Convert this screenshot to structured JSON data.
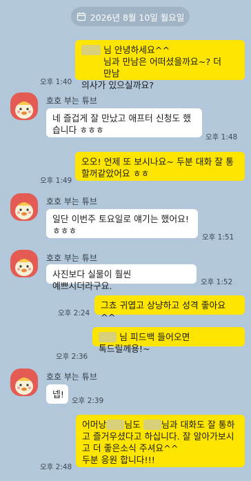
{
  "date_divider": "2026년 8월 10일 월요일",
  "colors": {
    "background": "#b2c7d9",
    "my_bubble": "#fee500",
    "their_bubble": "#ffffff",
    "avatar": "#e35b53"
  },
  "sender_name": "호호 부는 튜브",
  "messages": [
    {
      "from": "me",
      "lines": [
        "님 안녕하세요^^",
        "님과 만남은 어떠셨을까요~? 더 만남",
        "의사가 있으실까요?"
      ],
      "time": "오후 1:40"
    },
    {
      "from": "them",
      "lines": [
        "네 즐겁게 잘 만났고 애프터 신청도 했",
        "습니다 ㅎㅎㅎ"
      ],
      "time": "오후 1:48"
    },
    {
      "from": "me",
      "lines": [
        "오오! 언제 또 보시나요~ 두분 대화 잘 통",
        "할꺼같았어요 ㅎㅎ"
      ],
      "time": "오후 1:49"
    },
    {
      "from": "them",
      "lines": [
        "일단 이번주 토요일로 얘기는 했어요!",
        "ㅎㅎㅎ"
      ],
      "time": "오후 1:51"
    },
    {
      "from": "them",
      "lines": [
        "사진보다 실물이 훨씬 예쁘시더라구요."
      ],
      "time": "오후 1:52"
    },
    {
      "from": "me",
      "lines": [
        "그쵸 귀엽고 상냥하고 성격 좋아요^^"
      ],
      "time": "오후 2:24"
    },
    {
      "from": "me",
      "lines": [
        "님 피드백 들어오면 톡드릴께용!~"
      ],
      "time": "오후 2:36"
    },
    {
      "from": "them",
      "lines": [
        "넵!"
      ],
      "time": "오후 2:39"
    },
    {
      "from": "me",
      "lines": [
        "어머낭",
        "님도",
        "님과 대화도 잘 통하",
        "고 즐거우셨다고 하십니다. 잘 알아가보시",
        "고 더 좋은소식 주셔요^^",
        "두분 응원 합니다!!!"
      ],
      "time": "오후 2:48"
    }
  ]
}
